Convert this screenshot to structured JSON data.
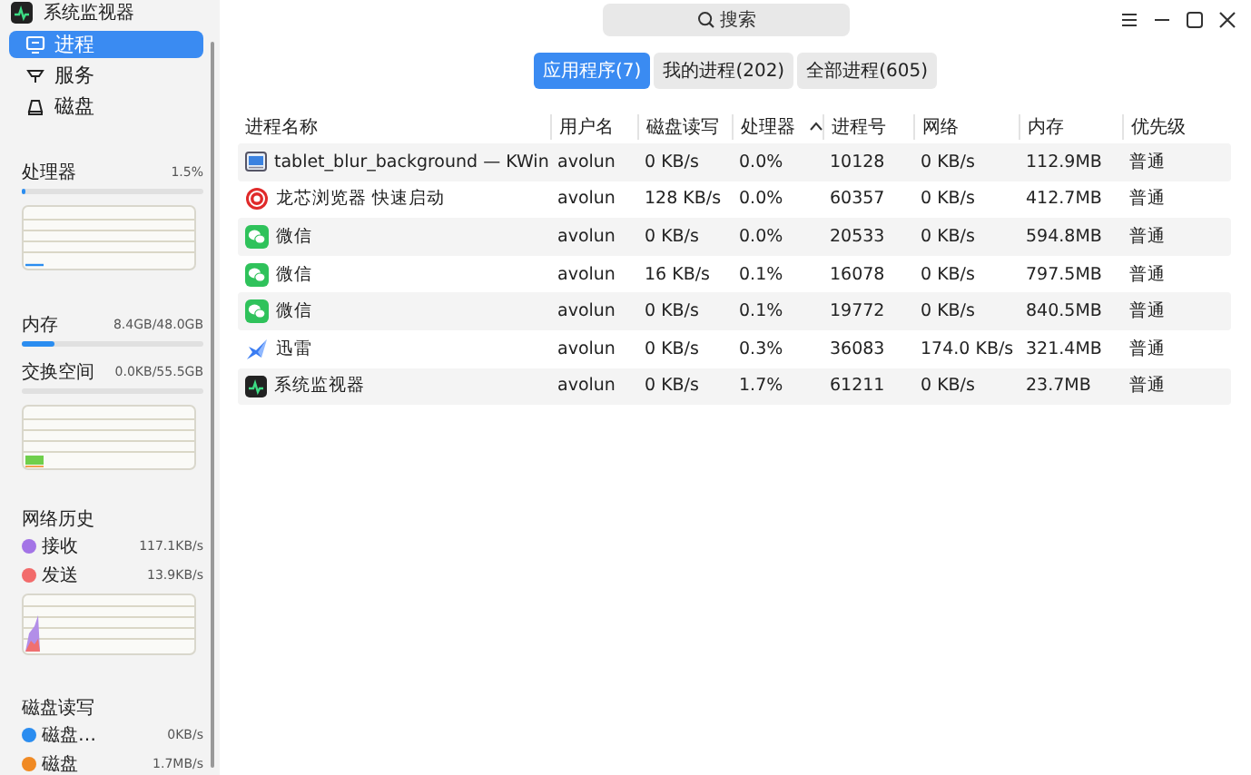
{
  "window": {
    "title": "系统监视器"
  },
  "sidebar": {
    "nav": [
      {
        "label": "进程",
        "selected": true
      },
      {
        "label": "服务",
        "selected": false
      },
      {
        "label": "磁盘",
        "selected": false
      }
    ],
    "processor": {
      "title": "处理器",
      "reading": "1.5%",
      "level": 0.015
    },
    "memory": {
      "title": "内存",
      "reading": "8.4GB/48.0GB",
      "level": 0.175
    },
    "swap": {
      "title": "交换空间",
      "reading": "0.0KB/55.5GB",
      "level": 0
    },
    "network": {
      "title": "网络历史",
      "items": [
        {
          "label": "接收",
          "reading": "117.1KB/s",
          "color": "#a374e6"
        },
        {
          "label": "发送",
          "reading": "13.9KB/s",
          "color": "#f26b6b"
        }
      ]
    },
    "disk_io": {
      "title": "磁盘读写",
      "items": [
        {
          "label": "磁盘…",
          "reading": "0KB/s",
          "color": "#2b8df0"
        },
        {
          "label": "磁盘",
          "reading": "1.7MB/s",
          "color": "#f08a24"
        }
      ]
    }
  },
  "search": {
    "placeholder": "搜索"
  },
  "tabs": [
    {
      "label": "应用程序(7)",
      "selected": true
    },
    {
      "label": "我的进程(202)",
      "selected": false
    },
    {
      "label": "全部进程(605)",
      "selected": false
    }
  ],
  "table": {
    "columns": [
      {
        "label": "进程名称",
        "sorted": false
      },
      {
        "label": "用户名",
        "sorted": false
      },
      {
        "label": "磁盘读写",
        "sorted": false
      },
      {
        "label": "处理器",
        "sorted": true
      },
      {
        "label": "进程号",
        "sorted": false
      },
      {
        "label": "网络",
        "sorted": false
      },
      {
        "label": "内存",
        "sorted": false
      },
      {
        "label": "优先级",
        "sorted": false
      }
    ],
    "rows": [
      {
        "kind": "window",
        "cells": [
          "tablet_blur_background — KWin",
          "avolun",
          "0 KB/s",
          "0.0%",
          "10128",
          "0 KB/s",
          "112.9MB",
          "普通"
        ]
      },
      {
        "kind": "browser",
        "cells": [
          "龙芯浏览器 快速启动",
          "avolun",
          "128 KB/s",
          "0.0%",
          "60357",
          "0 KB/s",
          "412.7MB",
          "普通"
        ]
      },
      {
        "kind": "chat",
        "cells": [
          "微信",
          "avolun",
          "0 KB/s",
          "0.0%",
          "20533",
          "0 KB/s",
          "594.8MB",
          "普通"
        ]
      },
      {
        "kind": "chat",
        "cells": [
          "微信",
          "avolun",
          "16 KB/s",
          "0.1%",
          "16078",
          "0 KB/s",
          "797.5MB",
          "普通"
        ]
      },
      {
        "kind": "chat",
        "cells": [
          "微信",
          "avolun",
          "0 KB/s",
          "0.1%",
          "19772",
          "0 KB/s",
          "840.5MB",
          "普通"
        ]
      },
      {
        "kind": "bird",
        "cells": [
          "迅雷",
          "avolun",
          "0 KB/s",
          "0.3%",
          "36083",
          "174.0 KB/s",
          "321.4MB",
          "普通"
        ]
      },
      {
        "kind": "monitor",
        "cells": [
          "系统监视器",
          "avolun",
          "0 KB/s",
          "1.7%",
          "61211",
          "0 KB/s",
          "23.7MB",
          "普通"
        ]
      }
    ]
  }
}
